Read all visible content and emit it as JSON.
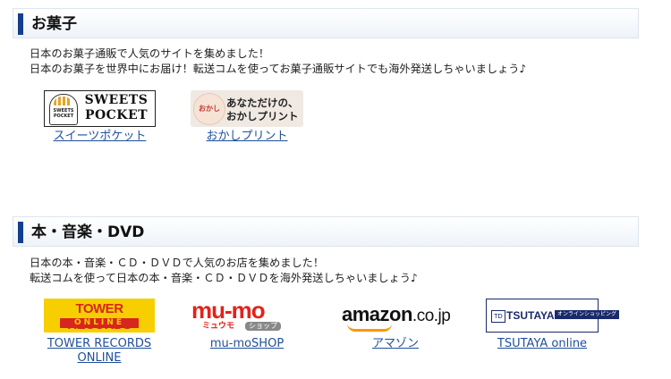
{
  "sections": [
    {
      "title": "お菓子",
      "desc_line1": "日本のお菓子通販で人気のサイトを集めました！",
      "desc_line2": "日本のお菓子を世界中にお届け！転送コムを使ってお菓子通販サイトでも海外発送しちゃいましょう♪",
      "items": [
        {
          "label": "スイーツポケット",
          "logo_text": "SWEETS POCKET",
          "logo_badge": "SWEETS POCKET"
        },
        {
          "label": "おかしプリント",
          "logo_line1": "あなただけの、",
          "logo_line2": "おかしプリント",
          "logo_badge": "おかし"
        }
      ]
    },
    {
      "title": "本・音楽・DVD",
      "desc_line1": "日本の本・音楽・ＣＤ・ＤＶＤで人気のお店を集めました！",
      "desc_line2": "転送コムを使って日本の本・音楽・ＣＤ・ＤＶＤを海外発送しちゃいましょう♪",
      "items": [
        {
          "label_line1": "TOWER RECORDS",
          "label_line2": "ONLINE",
          "logo_line1": "TOWER RECORDS",
          "logo_line2": "ONLINE"
        },
        {
          "label": "mu-moSHOP",
          "logo_big": "mu-mo",
          "logo_kana": "ミュウモ",
          "logo_shop": "ショップ"
        },
        {
          "label": "アマゾン",
          "logo_word": "amazon",
          "logo_suffix": ".co.jp"
        },
        {
          "label": "TSUTAYA online",
          "logo_name": "TSUTAYA",
          "logo_tag": "オンラインショッピング",
          "logo_mark": "TD"
        }
      ]
    }
  ],
  "colors": {
    "accent_bar": "#123f8c",
    "link": "#1f4f9b"
  }
}
